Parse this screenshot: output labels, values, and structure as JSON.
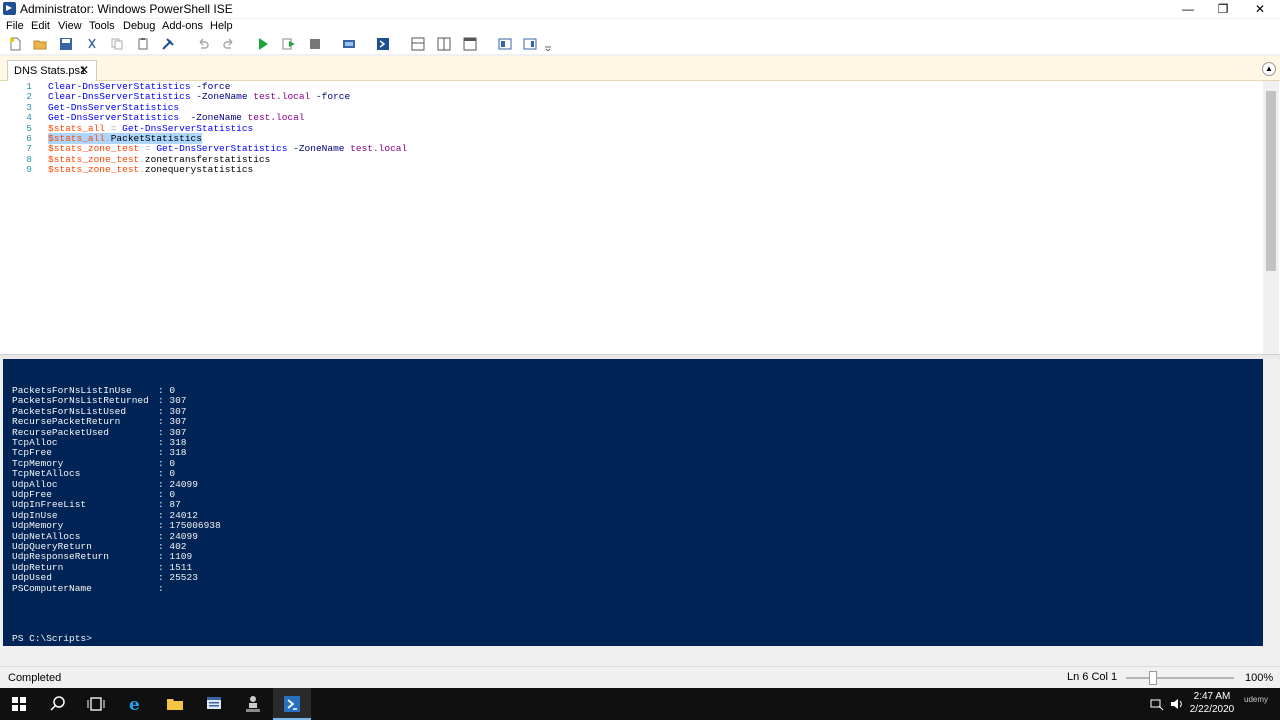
{
  "window": {
    "title": "Administrator: Windows PowerShell ISE"
  },
  "menu": [
    "File",
    "Edit",
    "View",
    "Tools",
    "Debug",
    "Add-ons",
    "Help"
  ],
  "tab": {
    "label": "DNS Stats.ps1",
    "close_glyph": "✕"
  },
  "script": {
    "line_numbers": [
      "1",
      "2",
      "3",
      "4",
      "5",
      "6",
      "7",
      "8",
      "9"
    ],
    "lines": [
      [
        {
          "t": "cmd",
          "v": "Clear-DnsServerStatistics"
        },
        {
          "t": "sp",
          "v": " "
        },
        {
          "t": "param",
          "v": "-force"
        }
      ],
      [
        {
          "t": "cmd",
          "v": "Clear-DnsServerStatistics"
        },
        {
          "t": "sp",
          "v": " "
        },
        {
          "t": "param",
          "v": "-ZoneName"
        },
        {
          "t": "sp",
          "v": " "
        },
        {
          "t": "str",
          "v": "test.local"
        },
        {
          "t": "sp",
          "v": " "
        },
        {
          "t": "param",
          "v": "-force"
        }
      ],
      [
        {
          "t": "cmd",
          "v": "Get-DnsServerStatistics"
        }
      ],
      [
        {
          "t": "cmd",
          "v": "Get-DnsServerStatistics"
        },
        {
          "t": "sp",
          "v": "  "
        },
        {
          "t": "param",
          "v": "-ZoneName"
        },
        {
          "t": "sp",
          "v": " "
        },
        {
          "t": "str",
          "v": "test.local"
        }
      ],
      [
        {
          "t": "var",
          "v": "$stats_all"
        },
        {
          "t": "sp",
          "v": " "
        },
        {
          "t": "op",
          "v": "="
        },
        {
          "t": "sp",
          "v": " "
        },
        {
          "t": "cmd",
          "v": "Get-DnsServerStatistics"
        }
      ],
      [
        {
          "t": "var",
          "v": "$stats_all",
          "hl": true
        },
        {
          "t": "op",
          "v": ".",
          "hl": true
        },
        {
          "t": "mem",
          "v": "PacketStatistics",
          "hl": true
        }
      ],
      [
        {
          "t": "var",
          "v": "$stats_zone_test"
        },
        {
          "t": "sp",
          "v": " "
        },
        {
          "t": "op",
          "v": "="
        },
        {
          "t": "sp",
          "v": " "
        },
        {
          "t": "cmd",
          "v": "Get-DnsServerStatistics"
        },
        {
          "t": "sp",
          "v": " "
        },
        {
          "t": "param",
          "v": "-ZoneName"
        },
        {
          "t": "sp",
          "v": " "
        },
        {
          "t": "str",
          "v": "test.local"
        }
      ],
      [
        {
          "t": "var",
          "v": "$stats_zone_test"
        },
        {
          "t": "op",
          "v": "."
        },
        {
          "t": "mem",
          "v": "zonetransferstatistics"
        }
      ],
      [
        {
          "t": "var",
          "v": "$stats_zone_test"
        },
        {
          "t": "op",
          "v": "."
        },
        {
          "t": "mem",
          "v": "zonequerystatistics"
        }
      ]
    ]
  },
  "console": {
    "rows": [
      {
        "name": "PacketsForNsListInUse",
        "value": "0"
      },
      {
        "name": "PacketsForNsListReturned",
        "value": "307"
      },
      {
        "name": "PacketsForNsListUsed",
        "value": "307"
      },
      {
        "name": "RecursePacketReturn",
        "value": "307"
      },
      {
        "name": "RecursePacketUsed",
        "value": "307"
      },
      {
        "name": "TcpAlloc",
        "value": "318"
      },
      {
        "name": "TcpFree",
        "value": "318"
      },
      {
        "name": "TcpMemory",
        "value": "0"
      },
      {
        "name": "TcpNetAllocs",
        "value": "0"
      },
      {
        "name": "UdpAlloc",
        "value": "24099"
      },
      {
        "name": "UdpFree",
        "value": "0"
      },
      {
        "name": "UdpInFreeList",
        "value": "87"
      },
      {
        "name": "UdpInUse",
        "value": "24012"
      },
      {
        "name": "UdpMemory",
        "value": "175006938"
      },
      {
        "name": "UdpNetAllocs",
        "value": "24099"
      },
      {
        "name": "UdpQueryReturn",
        "value": "402"
      },
      {
        "name": "UdpResponseReturn",
        "value": "1109"
      },
      {
        "name": "UdpReturn",
        "value": "1511"
      },
      {
        "name": "UdpUsed",
        "value": "25523"
      },
      {
        "name": "PSComputerName",
        "value": ""
      }
    ],
    "prompt": "PS C:\\Scripts>"
  },
  "status": {
    "text": "Completed",
    "cursor": "Ln 6  Col 1",
    "zoom": "100%"
  },
  "taskbar": {
    "time": "2:47 AM",
    "date": "2/22/2020",
    "watermark": "udemy"
  },
  "colors": {
    "console_bg": "#012456",
    "cmdlet": "#0000ff",
    "variable": "#ff4500",
    "string": "#8b008b",
    "parameter": "#000080",
    "selection": "#add6ff"
  }
}
